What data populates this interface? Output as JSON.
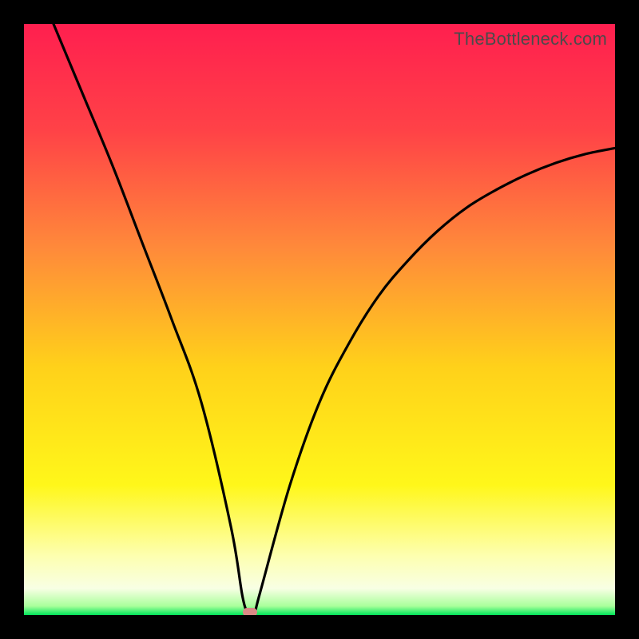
{
  "watermark": "TheBottleneck.com",
  "colors": {
    "frame": "#000000",
    "gradient_stops": [
      {
        "pos": 0.0,
        "color": "#ff1f4f"
      },
      {
        "pos": 0.18,
        "color": "#ff4247"
      },
      {
        "pos": 0.38,
        "color": "#ff8a3a"
      },
      {
        "pos": 0.58,
        "color": "#ffd11a"
      },
      {
        "pos": 0.78,
        "color": "#fff71a"
      },
      {
        "pos": 0.9,
        "color": "#fdffb0"
      },
      {
        "pos": 0.955,
        "color": "#f8ffe4"
      },
      {
        "pos": 0.985,
        "color": "#a8ff9a"
      },
      {
        "pos": 1.0,
        "color": "#00e55a"
      }
    ],
    "curve": "#000000",
    "marker": "#d98a86"
  },
  "chart_data": {
    "type": "line",
    "title": "",
    "xlabel": "",
    "ylabel": "",
    "xlim": [
      0,
      100
    ],
    "ylim": [
      0,
      100
    ],
    "series": [
      {
        "name": "bottleneck-curve",
        "x": [
          5,
          10,
          15,
          20,
          25,
          30,
          35,
          37,
          38,
          39,
          40,
          45,
          50,
          55,
          60,
          65,
          70,
          75,
          80,
          85,
          90,
          95,
          100
        ],
        "y": [
          100,
          88,
          76,
          63,
          50,
          36,
          15,
          3,
          0.5,
          0.5,
          4,
          22,
          36,
          46,
          54,
          60,
          65,
          69,
          72,
          74.5,
          76.5,
          78,
          79
        ]
      }
    ],
    "marker": {
      "x": 38.3,
      "y": 0.5
    },
    "annotations": []
  }
}
